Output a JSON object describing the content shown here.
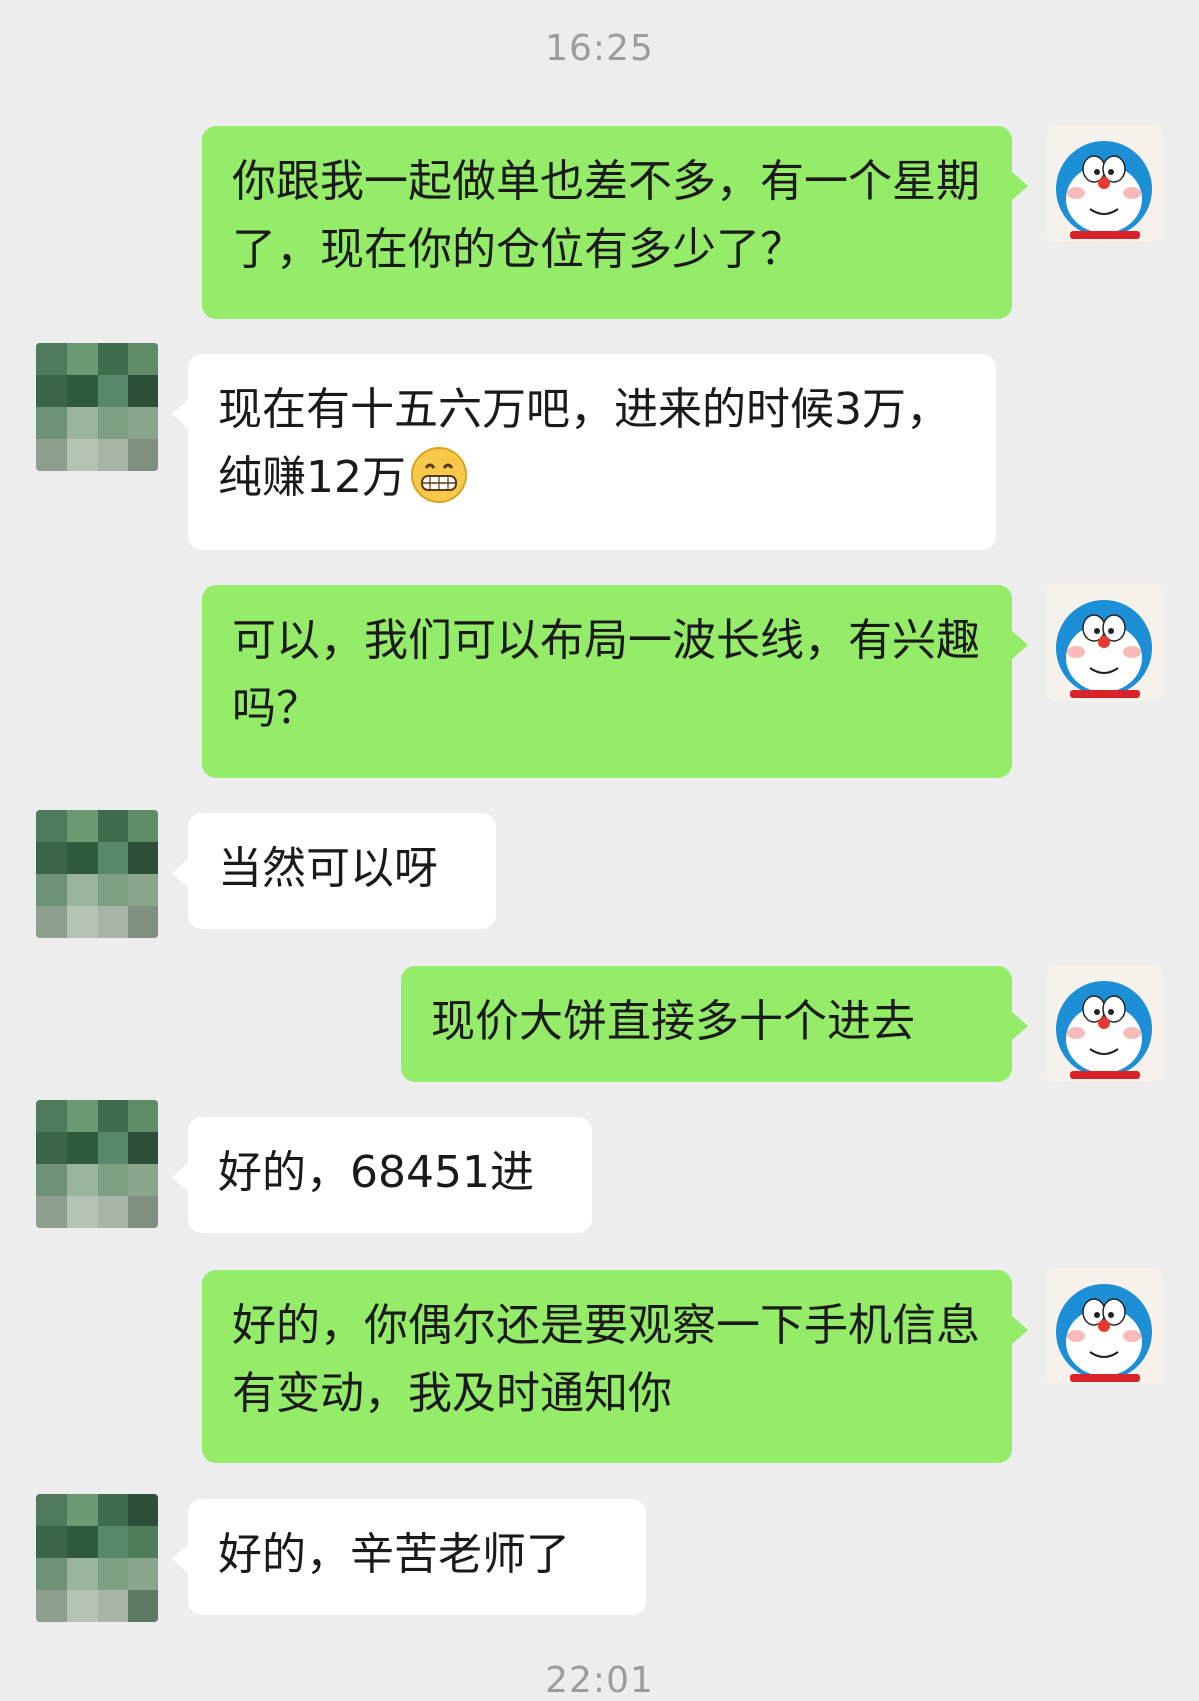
{
  "chat": {
    "timestamp_top": "16:25",
    "timestamp_bottom": "22:01",
    "messages": [
      {
        "side": "out",
        "text": "你跟我一起做单也差不多，有一个星期了，现在你的仓位有多少了？"
      },
      {
        "side": "in",
        "text": "现在有十五六万吧，进来的时候3万，纯赚12万",
        "emoji": "grinning-face-emoji"
      },
      {
        "side": "out",
        "text": "可以，我们可以布局一波长线，有兴趣吗？"
      },
      {
        "side": "in",
        "text": "当然可以呀"
      },
      {
        "side": "out",
        "text": "现价大饼直接多十个进去"
      },
      {
        "side": "in",
        "text": "好的，68451进"
      },
      {
        "side": "out",
        "text": "好的，你偶尔还是要观察一下手机信息有变动，我及时通知你"
      },
      {
        "side": "in",
        "text": "好的，辛苦老师了"
      }
    ]
  },
  "avatars": {
    "self_icon": "doraemon-avatar-icon",
    "contact_icon": "pixelated-avatar-icon"
  },
  "colors": {
    "background": "#ededed",
    "outgoing_bubble": "#95ec69",
    "incoming_bubble": "#ffffff",
    "timestamp": "#9c9c9c"
  }
}
